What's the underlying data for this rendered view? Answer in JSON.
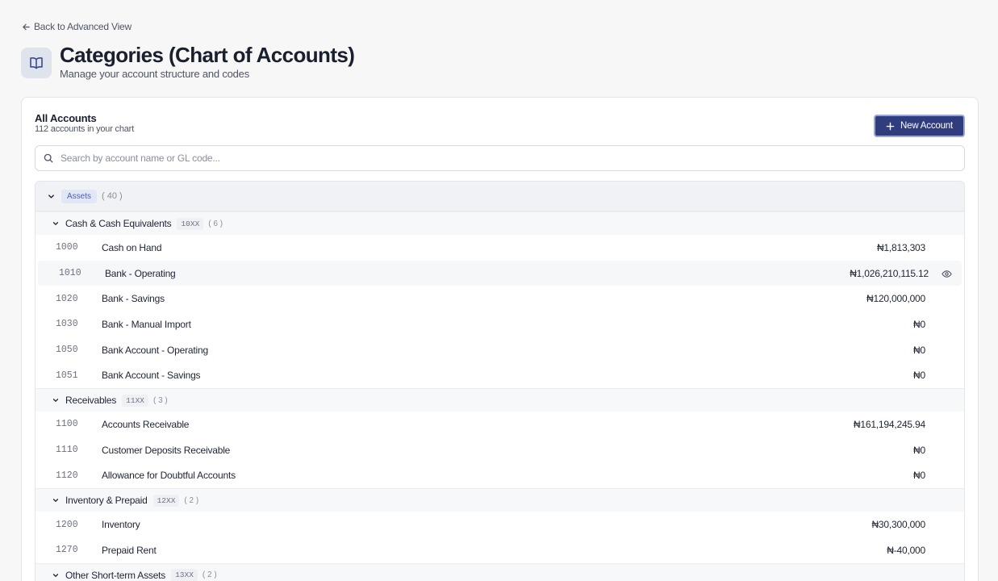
{
  "back": {
    "label": "Back to Advanced View"
  },
  "header": {
    "title": "Categories (Chart of Accounts)",
    "subtitle": "Manage your account structure and codes"
  },
  "card": {
    "title": "All Accounts",
    "subtitle": "112 accounts in your chart",
    "new_button": "New Account"
  },
  "search": {
    "placeholder": "Search by account name or GL code..."
  },
  "group": {
    "label": "Assets",
    "count": "( 40 )"
  },
  "sections": [
    {
      "label": "Cash & Cash Equivalents",
      "code": "10XX",
      "count": "( 6 )"
    },
    {
      "label": "Receivables",
      "code": "11XX",
      "count": "( 3 )"
    },
    {
      "label": "Inventory & Prepaid",
      "code": "12XX",
      "count": "( 2 )"
    },
    {
      "label": "Other Short-term Assets",
      "code": "13XX",
      "count": "( 2 )"
    }
  ],
  "accounts": [
    {
      "code": "1000",
      "name": "Cash on Hand",
      "amount": "₦1,813,303"
    },
    {
      "code": "1010",
      "name": "Bank - Operating",
      "amount": "₦1,026,210,115.12"
    },
    {
      "code": "1020",
      "name": "Bank - Savings",
      "amount": "₦120,000,000"
    },
    {
      "code": "1030",
      "name": "Bank - Manual Import",
      "amount": "₦0"
    },
    {
      "code": "1050",
      "name": "Bank Account - Operating",
      "amount": "₦0"
    },
    {
      "code": "1051",
      "name": "Bank Account - Savings",
      "amount": "₦0"
    },
    {
      "code": "1100",
      "name": "Accounts Receivable",
      "amount": "₦161,194,245.94"
    },
    {
      "code": "1110",
      "name": "Customer Deposits Receivable",
      "amount": "₦0"
    },
    {
      "code": "1120",
      "name": "Allowance for Doubtful Accounts",
      "amount": "₦0"
    },
    {
      "code": "1200",
      "name": "Inventory",
      "amount": "₦30,300,000"
    },
    {
      "code": "1270",
      "name": "Prepaid Rent",
      "amount": "₦-40,000"
    }
  ]
}
